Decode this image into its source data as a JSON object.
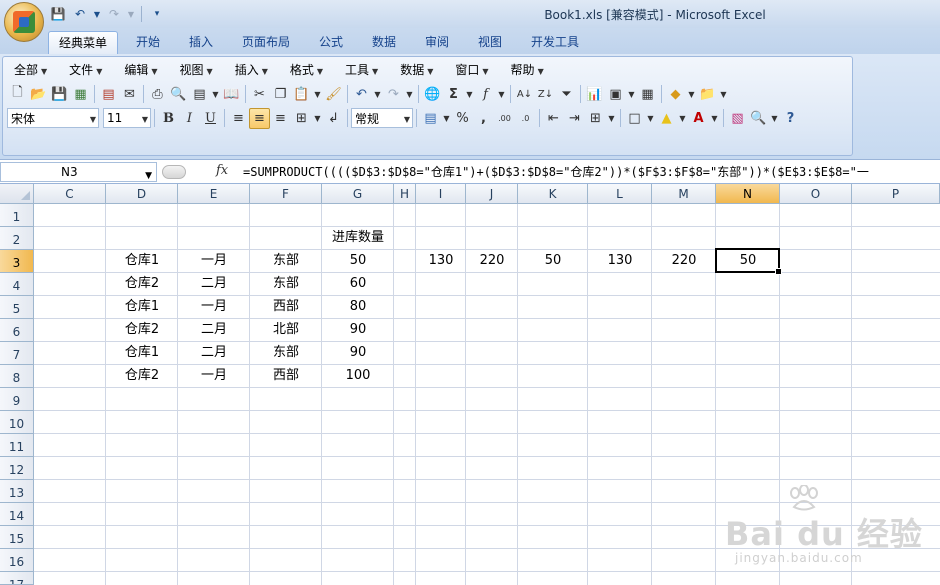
{
  "window": {
    "title": "Book1.xls  [兼容模式] - Microsoft Excel"
  },
  "ribbon": {
    "tabs": [
      "经典菜单",
      "开始",
      "插入",
      "页面布局",
      "公式",
      "数据",
      "审阅",
      "视图",
      "开发工具"
    ],
    "active_tab": "经典菜单",
    "menus": [
      "全部",
      "文件",
      "编辑",
      "视图",
      "插入",
      "格式",
      "工具",
      "数据",
      "窗口",
      "帮助"
    ],
    "font_name": "宋体",
    "font_size": "11",
    "number_format": "常规",
    "bold_label": "B",
    "italic_label": "I",
    "underline_label": "U"
  },
  "formula_bar": {
    "name_box": "N3",
    "fx_label": "fx",
    "formula": "=SUMPRODUCT(((($D$3:$D$8=\"仓库1\")+($D$3:$D$8=\"仓库2\"))*($F$3:$F$8=\"东部\"))*($E$3:$E$8=\"一"
  },
  "sheet": {
    "columns": [
      "C",
      "D",
      "E",
      "F",
      "G",
      "H",
      "I",
      "J",
      "K",
      "L",
      "M",
      "N",
      "O",
      "P"
    ],
    "selected_column": "N",
    "rows": [
      "1",
      "2",
      "3",
      "4",
      "5",
      "6",
      "7",
      "8",
      "9",
      "10",
      "11",
      "12",
      "13",
      "14",
      "15",
      "16",
      "17"
    ],
    "selected_row": "3",
    "header_G2": "进库数量",
    "data": [
      {
        "D": "仓库1",
        "E": "一月",
        "F": "东部",
        "G": "50"
      },
      {
        "D": "仓库2",
        "E": "二月",
        "F": "东部",
        "G": "60"
      },
      {
        "D": "仓库1",
        "E": "一月",
        "F": "西部",
        "G": "80"
      },
      {
        "D": "仓库2",
        "E": "二月",
        "F": "北部",
        "G": "90"
      },
      {
        "D": "仓库1",
        "E": "二月",
        "F": "东部",
        "G": "90"
      },
      {
        "D": "仓库2",
        "E": "一月",
        "F": "西部",
        "G": "100"
      }
    ],
    "row3_results": {
      "I": "130",
      "J": "220",
      "K": "50",
      "L": "130",
      "M": "220",
      "N": "50"
    }
  },
  "watermark": {
    "brand": "Bai du 经验",
    "url": "jingyan.baidu.com"
  }
}
